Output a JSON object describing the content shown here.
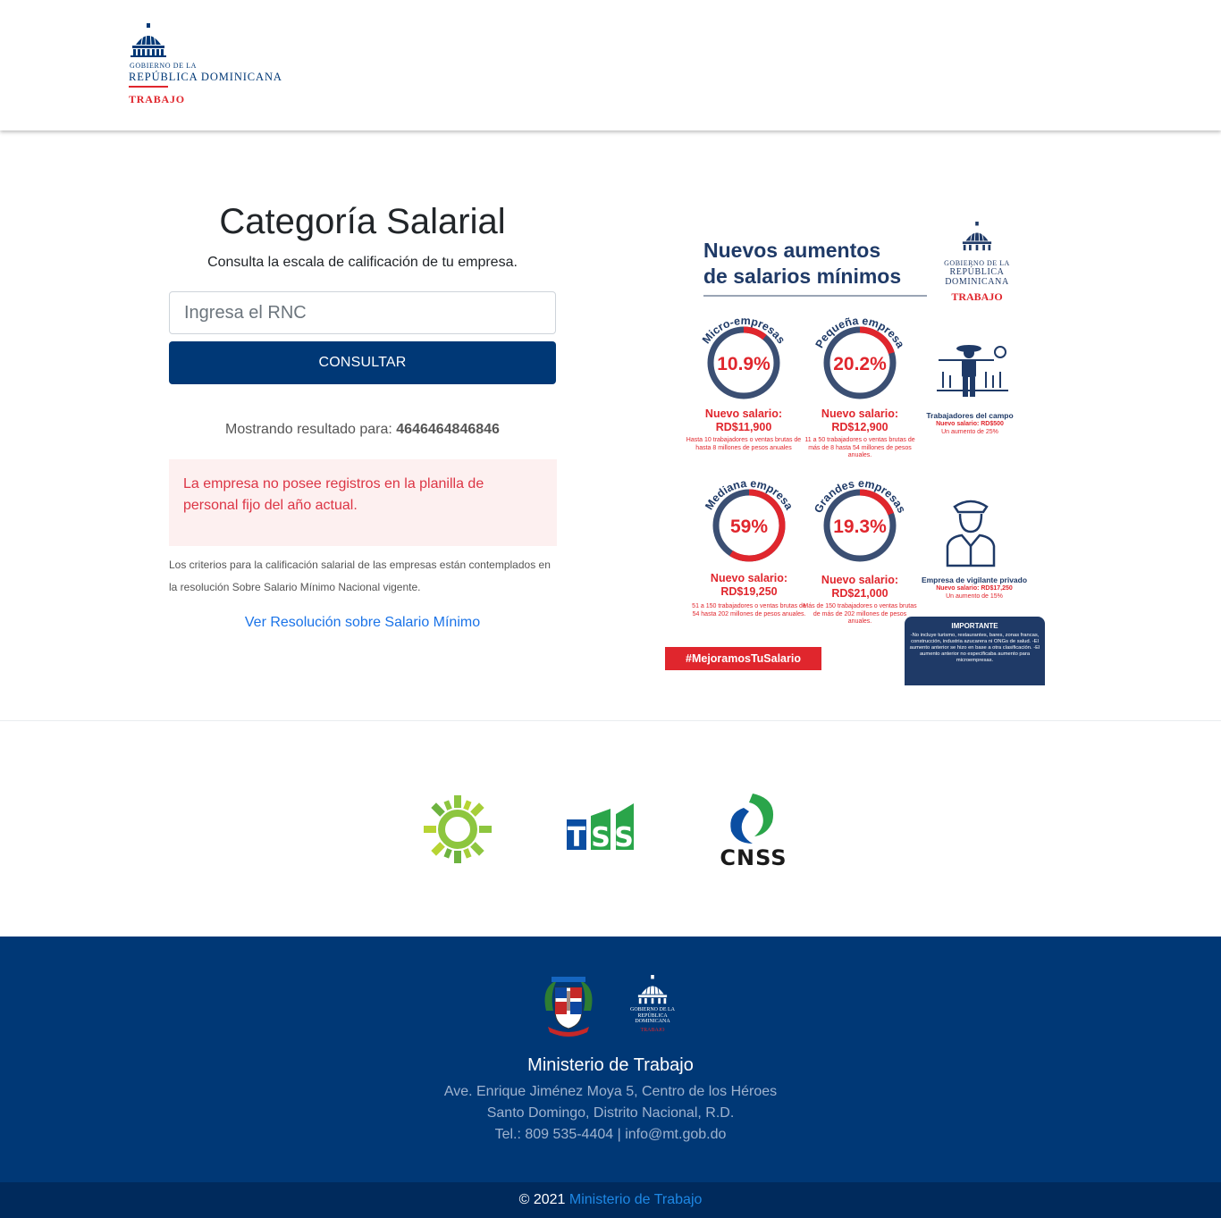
{
  "header": {
    "logo": {
      "line1": "GOBIERNO DE LA",
      "line2": "REPÚBLICA DOMINICANA",
      "dept": "TRABAJO"
    }
  },
  "main": {
    "title": "Categoría Salarial",
    "subtitle": "Consulta la escala de calificación de tu empresa.",
    "search": {
      "placeholder": "Ingresa el RNC",
      "value": ""
    },
    "consult_label": "CONSULTAR",
    "result_prefix": "Mostrando resultado para:",
    "result_rnc": "4646464846846",
    "alert_text": "La empresa no posee registros en la planilla de personal fijo del año actual.",
    "criteria_text": "Los criterios para la calificación salarial de las empresas están contemplados en la resolución Sobre Salario Mínimo Nacional vigente.",
    "resolution_link": "Ver Resolución sobre Salario Mínimo"
  },
  "poster": {
    "title_line1": "Nuevos aumentos",
    "title_line2": "de salarios mínimos",
    "logo_gob": "GOBIERNO DE LA",
    "logo_rep1": "REPÚBLICA",
    "logo_rep2": "DOMINICANA",
    "logo_dept": "TRABAJO",
    "rings": [
      {
        "name": "Micro-empresas",
        "percent": "10.9%",
        "fraction": 0.109,
        "salary_label": "Nuevo salario:",
        "salary": "RD$11,900",
        "note": "Hasta 10 trabajadores o ventas brutas de hasta 8 millones de pesos anuales"
      },
      {
        "name": "Pequeña empresa",
        "percent": "20.2%",
        "fraction": 0.202,
        "salary_label": "Nuevo salario:",
        "salary": "RD$12,900",
        "note": "11 a 50 trabajadores o ventas brutas de más de 8 hasta 54 millones de pesos anuales."
      },
      {
        "name": "Mediana empresa",
        "percent": "59%",
        "fraction": 0.59,
        "salary_label": "Nuevo salario:",
        "salary": "RD$19,250",
        "note": "51 a 150 trabajadores o ventas brutas de 54 hasta 202 millones de pesos anuales."
      },
      {
        "name": "Grandes empresas",
        "percent": "19.3%",
        "fraction": 0.193,
        "salary_label": "Nuevo salario:",
        "salary": "RD$21,000",
        "note": "Más de 150 trabajadores o ventas brutas de más de 202 millones de pesos anuales."
      }
    ],
    "campo": {
      "title": "Trabajadores del campo",
      "salary": "Nuevo salario: RD$500",
      "increase": "Un aumento de 25%"
    },
    "vigilante": {
      "title": "Empresa de vigilante privado",
      "salary": "Nuevo salario: RD$17,250",
      "increase": "Un aumento de 15%"
    },
    "hashtag": "#MejoramosTuSalario",
    "important_title": "IMPORTANTE",
    "important_body": "-No incluye turismo, restaurantes, bares, zonas francas, construcción, industria azucarera ni ONGs de salud. -El aumento anterior se hizo en base a otra clasificación. -El aumento anterior no especificaba aumento para microempresas."
  },
  "partners": [
    {
      "name": "sun-logo"
    },
    {
      "name": "TSS"
    },
    {
      "name": "CNSS"
    }
  ],
  "footer": {
    "seal_dept": "TRABAJO",
    "name": "Ministerio de Trabajo",
    "address1": "Ave. Enrique Jiménez Moya 5, Centro de los Héroes",
    "address2": "Santo Domingo, Distrito Nacional, R.D.",
    "contact": "Tel.: 809 535-4404 | info@mt.gob.do",
    "copyright": "© 2021",
    "copyright_link": "Ministerio de Trabajo"
  },
  "colors": {
    "brand_blue": "#003876",
    "brand_red": "#e0262d",
    "alert_bg": "#fdf0f0",
    "alert_text": "#dc3545",
    "link": "#1a73e8"
  }
}
